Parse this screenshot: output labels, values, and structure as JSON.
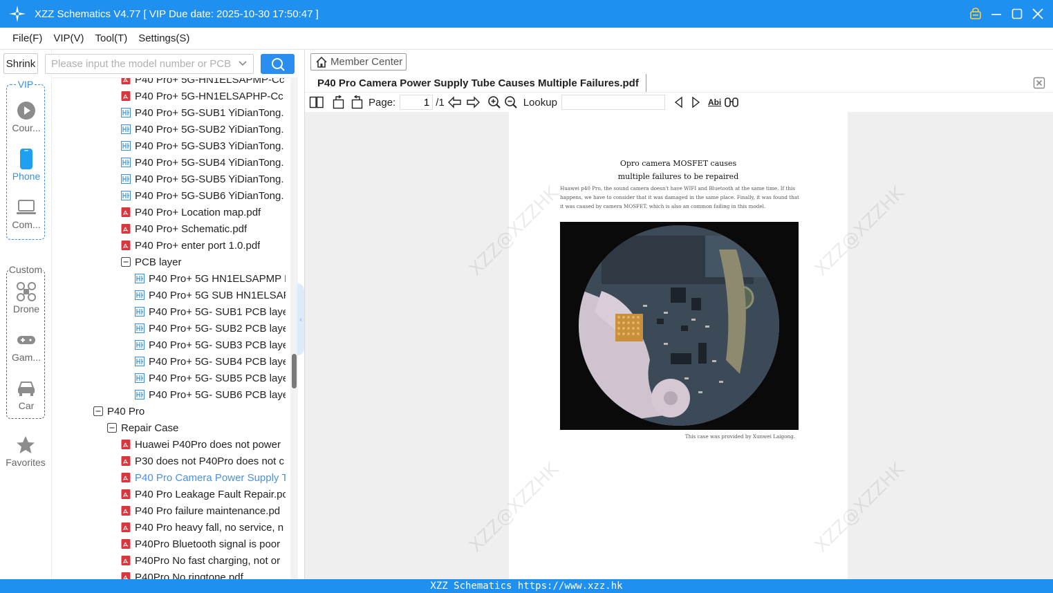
{
  "window": {
    "title": "XZZ Schematics V4.77 [ VIP Due date: 2025-10-30 17:50:47 ]",
    "logo_icon": "sparkle-star-icon",
    "controls": [
      "vip-lock-icon",
      "minimize-icon",
      "maximize-icon",
      "close-icon"
    ]
  },
  "menu": {
    "file": "File(F)",
    "vip": "VIP(V)",
    "tool": "Tool(T)",
    "settings": "Settings(S)"
  },
  "sidebar": {
    "shrink_label": "Shrink",
    "vip_group_label": "VIP",
    "custom_group_label": "Custom",
    "items": [
      {
        "label": "Cour...",
        "icon": "play-circle-icon"
      },
      {
        "label": "Phone",
        "icon": "phone-icon",
        "active": true
      },
      {
        "label": "Com...",
        "icon": "laptop-icon"
      },
      {
        "label": "Drone",
        "icon": "drone-icon"
      },
      {
        "label": "Gam...",
        "icon": "gamepad-icon"
      },
      {
        "label": "Car",
        "icon": "car-icon"
      },
      {
        "label": "Favorites",
        "icon": "star-icon"
      }
    ]
  },
  "search": {
    "placeholder": "Please input the model number or PCB"
  },
  "tree": {
    "rows": [
      {
        "text": "P40 Pro+ 5G-HN1ELSAPMP-Cc",
        "type": "pdf",
        "level": 2
      },
      {
        "text": "P40 Pro+ 5G-HN1ELSAPHP-Cc",
        "type": "pdf",
        "level": 2
      },
      {
        "text": "P40 Pro+ 5G-SUB1 YiDianTong.",
        "type": "pcb",
        "level": 2
      },
      {
        "text": "P40 Pro+ 5G-SUB2 YiDianTong.",
        "type": "pcb",
        "level": 2
      },
      {
        "text": "P40 Pro+ 5G-SUB3 YiDianTong.",
        "type": "pcb",
        "level": 2
      },
      {
        "text": "P40 Pro+ 5G-SUB4 YiDianTong.",
        "type": "pcb",
        "level": 2
      },
      {
        "text": "P40 Pro+ 5G-SUB5 YiDianTong.",
        "type": "pcb",
        "level": 2
      },
      {
        "text": "P40 Pro+ 5G-SUB6 YiDianTong.",
        "type": "pcb",
        "level": 2
      },
      {
        "text": "P40 Pro+ Location map.pdf",
        "type": "pdf",
        "level": 2
      },
      {
        "text": "P40 Pro+ Schematic.pdf",
        "type": "pdf",
        "level": 2
      },
      {
        "text": "P40 Pro+ enter port 1.0.pdf",
        "type": "pdf",
        "level": 2
      },
      {
        "text": "PCB layer",
        "type": "folder",
        "level": 2
      },
      {
        "text": "P40 Pro+ 5G HN1ELSAPMP F",
        "type": "pcb",
        "level": 3
      },
      {
        "text": "P40 Pro+ 5G SUB HN1ELSAP",
        "type": "pcb",
        "level": 3
      },
      {
        "text": "P40 Pro+ 5G- SUB1 PCB laye",
        "type": "pcb",
        "level": 3
      },
      {
        "text": "P40 Pro+ 5G- SUB2 PCB laye",
        "type": "pcb",
        "level": 3
      },
      {
        "text": "P40 Pro+ 5G- SUB3 PCB laye",
        "type": "pcb",
        "level": 3
      },
      {
        "text": "P40 Pro+ 5G- SUB4 PCB laye",
        "type": "pcb",
        "level": 3
      },
      {
        "text": "P40 Pro+ 5G- SUB5 PCB laye",
        "type": "pcb",
        "level": 3
      },
      {
        "text": "P40 Pro+ 5G- SUB6 PCB laye",
        "type": "pcb",
        "level": 3
      },
      {
        "text": "P40 Pro",
        "type": "folder",
        "level": 0
      },
      {
        "text": "Repair Case",
        "type": "folder",
        "level": 1
      },
      {
        "text": "Huawei P40Pro does not power",
        "type": "pdf",
        "level": 2
      },
      {
        "text": "P30 does not P40Pro does not c",
        "type": "pdf",
        "level": 2
      },
      {
        "text": "P40 Pro Camera Power Supply T",
        "type": "pdf",
        "level": 2,
        "selected": true
      },
      {
        "text": "P40 Pro Leakage Fault Repair.pc",
        "type": "pdf",
        "level": 2
      },
      {
        "text": "P40 Pro failure maintenance.pd",
        "type": "pdf",
        "level": 2
      },
      {
        "text": "P40 Pro heavy fall, no service, n",
        "type": "pdf",
        "level": 2
      },
      {
        "text": "P40Pro Bluetooth signal is poor",
        "type": "pdf",
        "level": 2
      },
      {
        "text": "P40Pro No fast charging, not or",
        "type": "pdf",
        "level": 2
      },
      {
        "text": "P40Pro No ringtone.pdf",
        "type": "pdf",
        "level": 2
      }
    ]
  },
  "viewer": {
    "member_center_label": "Member Center",
    "doc_tab_title": "P40 Pro Camera Power Supply Tube Causes Multiple Failures.pdf",
    "toolbar": {
      "page_label": "Page:",
      "page_value": "1",
      "page_total": "/1",
      "lookup_label": "Lookup",
      "lookup_value": "",
      "abi_label": "Abi"
    },
    "pdf": {
      "title_line1": "Opro camera MOSFET causes",
      "title_line2": "multiple failures to be repaired",
      "body": "Huawei p40  Pro, the sound camera doesn't have WIFI and Bluetooth at the same time. If this happens, we have to consider that it was damaged in the same place. Finally, it was found that it was caused by camera MOSFET, which is also an common failing in this model.",
      "caption": "This case was provided by Xunwei Laigong.",
      "watermark": "XZZ@XZZHK"
    }
  },
  "statusbar": {
    "text": "XZZ Schematics https://www.xzz.hk"
  },
  "colors": {
    "accent": "#1f8ff0",
    "selected_text": "#4a90e2",
    "pdf_icon": "#d9363e",
    "pcb_icon": "#3b8fe0"
  }
}
